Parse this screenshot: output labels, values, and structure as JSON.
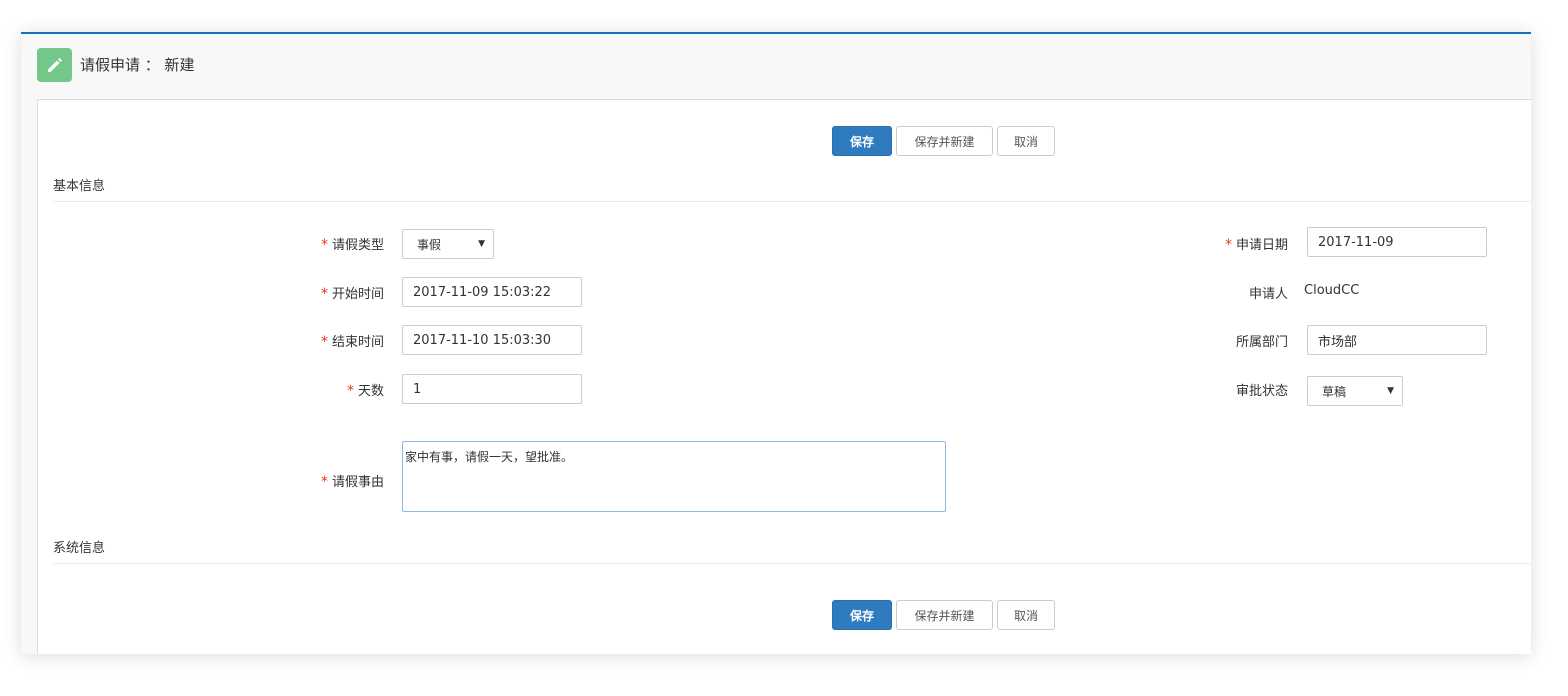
{
  "header": {
    "title": "请假申请 ： 新建",
    "icon": "pencil-icon",
    "icon_bg": "#73c889"
  },
  "buttons": {
    "save": "保存",
    "save_new": "保存并新建",
    "cancel": "取消",
    "primary_color": "#2f7bbf"
  },
  "sections": {
    "basic": "基本信息",
    "system": "系统信息"
  },
  "fields": {
    "leave_type": {
      "label": "请假类型",
      "value": "事假"
    },
    "start_time": {
      "label": "开始时间",
      "value": "2017-11-09 15:03:22"
    },
    "end_time": {
      "label": "结束时间",
      "value": "2017-11-10 15:03:30"
    },
    "days": {
      "label": "天数",
      "value": "1"
    },
    "reason": {
      "label": "请假事由",
      "value": "家中有事，请假一天，望批准。"
    },
    "apply_date": {
      "label": "申请日期",
      "value": "2017-11-09"
    },
    "applicant": {
      "label": "申请人",
      "value": "CloudCC"
    },
    "department": {
      "label": "所属部门",
      "value": "市场部"
    },
    "approval_status": {
      "label": "审批状态",
      "value": "草稿"
    }
  },
  "required_mark": "*"
}
